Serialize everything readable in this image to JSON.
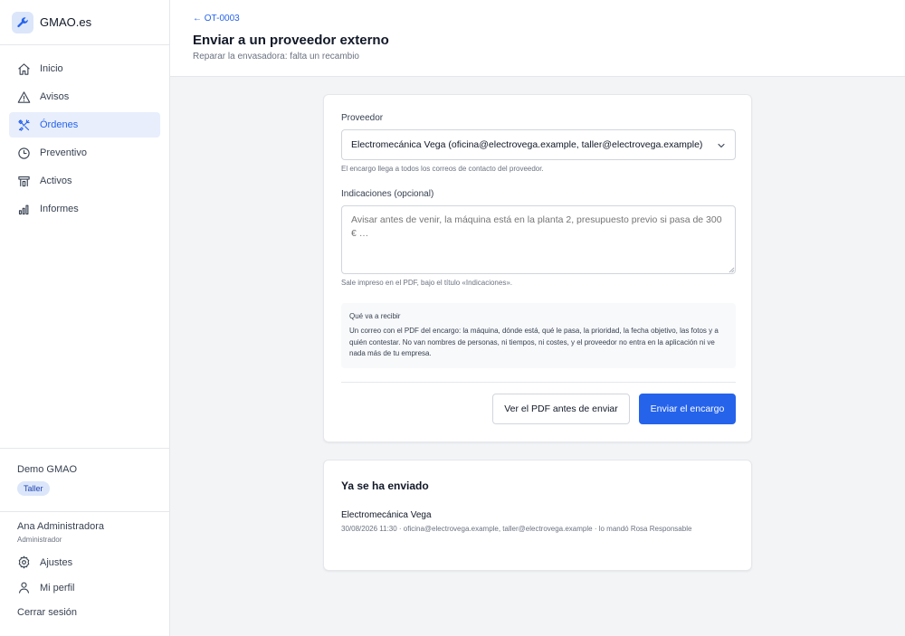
{
  "app": {
    "name": "GMAO.es",
    "logo_icon": "wrench-icon"
  },
  "colors": {
    "accent": "#2563eb",
    "active_bg": "#e8eefc",
    "badge_bg": "#dbe6fb"
  },
  "sidebar": {
    "items": [
      {
        "label": "Inicio",
        "icon": "home-icon",
        "active": false
      },
      {
        "label": "Avisos",
        "icon": "warning-icon",
        "active": false
      },
      {
        "label": "Órdenes",
        "icon": "tools-icon",
        "active": true
      },
      {
        "label": "Preventivo",
        "icon": "clock-icon",
        "active": false
      },
      {
        "label": "Activos",
        "icon": "asset-icon",
        "active": false
      },
      {
        "label": "Informes",
        "icon": "chart-icon",
        "active": false
      }
    ],
    "org": {
      "name": "Demo GMAO",
      "badge": "Taller"
    },
    "user": {
      "name": "Ana Administradora",
      "role": "Administrador"
    },
    "settings_label": "Ajustes",
    "profile_label": "Mi perfil",
    "logout_label": "Cerrar sesión"
  },
  "header": {
    "back_link": "← OT-0003",
    "title": "Enviar a un proveedor externo",
    "subtitle": "Reparar la envasadora: falta un recambio"
  },
  "form": {
    "provider_label": "Proveedor",
    "provider_value": "Electromecánica Vega (oficina@electrovega.example, taller@electrovega.example)",
    "provider_help": "El encargo llega a todos los correos de contacto del proveedor.",
    "notes_label": "Indicaciones (opcional)",
    "notes_placeholder": "Avisar antes de venir, la máquina está en la planta 2, presupuesto previo si pasa de 300 € …",
    "notes_help": "Sale impreso en el PDF, bajo el título «Indicaciones».",
    "info_title": "Qué va a recibir",
    "info_text": "Un correo con el PDF del encargo: la máquina, dónde está, qué le pasa, la prioridad, la fecha objetivo, las fotos y a quién contestar. No van nombres de personas, ni tiempos, ni costes, y el proveedor no entra en la aplicación ni ve nada más de tu empresa.",
    "preview_button": "Ver el PDF antes de enviar",
    "send_button": "Enviar el encargo"
  },
  "sent": {
    "title": "Ya se ha enviado",
    "entries": [
      {
        "name": "Electromecánica Vega",
        "meta": "30/08/2026 11:30 · oficina@electrovega.example, taller@electrovega.example · lo mandó Rosa Responsable"
      }
    ]
  }
}
